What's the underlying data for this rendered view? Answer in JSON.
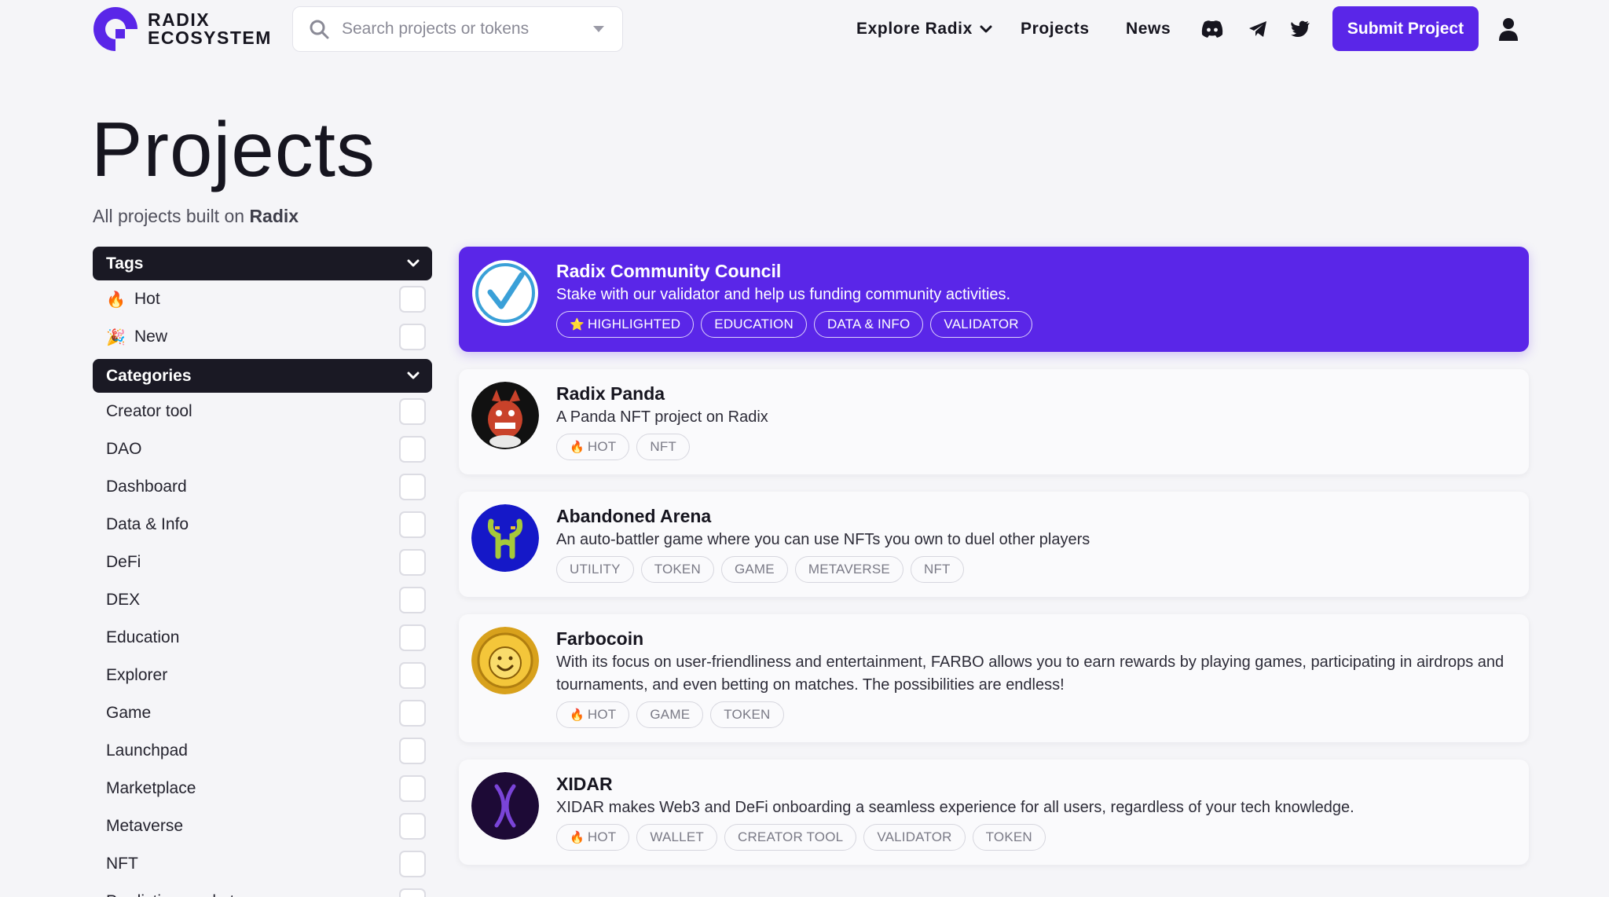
{
  "header": {
    "logo_line1": "RADIX",
    "logo_line2": "ECOSYSTEM",
    "search_placeholder": "Search projects or tokens",
    "nav": {
      "explore": "Explore Radix",
      "projects": "Projects",
      "news": "News"
    },
    "submit_label": "Submit Project",
    "icons": [
      "discord-icon",
      "telegram-icon",
      "twitter-icon",
      "user-icon"
    ]
  },
  "page": {
    "title": "Projects",
    "subtitle_prefix": "All projects built on",
    "subtitle_bold": "Radix"
  },
  "sidebar": {
    "tags_header": "Tags",
    "tags": [
      {
        "emoji": "🔥",
        "label": "Hot"
      },
      {
        "emoji": "🎉",
        "label": "New"
      }
    ],
    "categories_header": "Categories",
    "categories": [
      "Creator tool",
      "DAO",
      "Dashboard",
      "Data & Info",
      "DeFi",
      "DEX",
      "Education",
      "Explorer",
      "Game",
      "Launchpad",
      "Marketplace",
      "Metaverse",
      "NFT",
      "Prediction market"
    ]
  },
  "projects": [
    {
      "name": "Radix Community Council",
      "description": "Stake with our validator and help us funding community activities.",
      "tags": [
        "HIGHLIGHTED",
        "EDUCATION",
        "DATA & INFO",
        "VALIDATOR"
      ],
      "highlight_emoji": "⭐",
      "hot_emoji": "🔥"
    },
    {
      "name": "Radix Panda",
      "description": "A Panda NFT project on Radix",
      "tags": [
        "HOT",
        "NFT"
      ]
    },
    {
      "name": "Abandoned Arena",
      "description": "An auto-battler game where you can use NFTs you own to duel other players",
      "tags": [
        "UTILITY",
        "TOKEN",
        "GAME",
        "METAVERSE",
        "NFT"
      ]
    },
    {
      "name": "Farbocoin",
      "description": "With its focus on user-friendliness and entertainment, FARBO allows you to earn rewards by playing games, participating in airdrops and tournaments, and even betting on matches. The possibilities are endless!",
      "tags": [
        "HOT",
        "GAME",
        "TOKEN"
      ]
    },
    {
      "name": "XIDAR",
      "description": "XIDAR makes Web3 and DeFi onboarding a seamless experience for all users, regardless of your tech knowledge.",
      "tags": [
        "HOT",
        "WALLET",
        "CREATOR TOOL",
        "VALIDATOR",
        "TOKEN"
      ]
    }
  ],
  "colors": {
    "accent": "#5a26e8",
    "dark": "#1a1924",
    "background": "#f5f5f8"
  }
}
